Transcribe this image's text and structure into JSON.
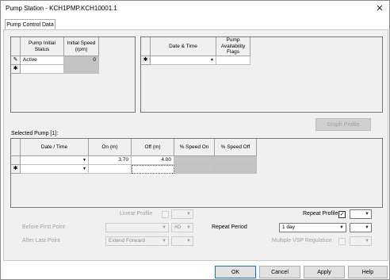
{
  "window": {
    "title": "Pump Station - KCH1PMP.KCH10001.1",
    "close_glyph": "✕"
  },
  "tabs": [
    {
      "label": "Pump Control Data"
    }
  ],
  "initial_grid": {
    "headers": [
      "Pump Initial Status",
      "Initial Speed (rpm)"
    ],
    "rows": [
      {
        "marker": "✎",
        "status": "Active",
        "speed": "0"
      },
      {
        "marker": "✱",
        "status": "",
        "speed": ""
      }
    ]
  },
  "availability_grid": {
    "headers": [
      "Date & Time",
      "Pump Availability Flags"
    ],
    "rows": [
      {
        "marker": "✱",
        "date": "",
        "flags": ""
      }
    ]
  },
  "graph_profile_button": "Graph Profile",
  "selected_pump_label": "Selected Pump [1]:",
  "pump_grid": {
    "headers": [
      "Date / Time",
      "On (m)",
      "Off (m)",
      "% Speed On",
      "% Speed Off"
    ],
    "rows": [
      {
        "marker": "",
        "date": "",
        "on": "3.70",
        "off": "4.00",
        "speed_on": "",
        "speed_off": ""
      },
      {
        "marker": "✱",
        "date": "",
        "on": "",
        "off": "",
        "speed_on": "",
        "speed_off": ""
      }
    ]
  },
  "profile": {
    "linear_profile_label": "Linear Profile",
    "before_first_point_label": "Before First Point",
    "before_first_point_value": "",
    "before_first_point_unit": "#D",
    "after_last_point_label": "After Last Point",
    "after_last_point_value": "Extend Forward",
    "repeat_profile_label": "Repeat Profile",
    "repeat_profile_checked": "✓",
    "repeat_period_label": "Repeat Period",
    "repeat_period_value": "1 day",
    "multiple_vsp_label": "Multiple VSP Regulation"
  },
  "footer": {
    "ok": "OK",
    "cancel": "Cancel",
    "apply": "Apply",
    "help": "Help"
  },
  "colors": {
    "accent": "#0078d7",
    "gray_cell": "#c4c4c4",
    "panel_bg": "#f0f0f0"
  }
}
